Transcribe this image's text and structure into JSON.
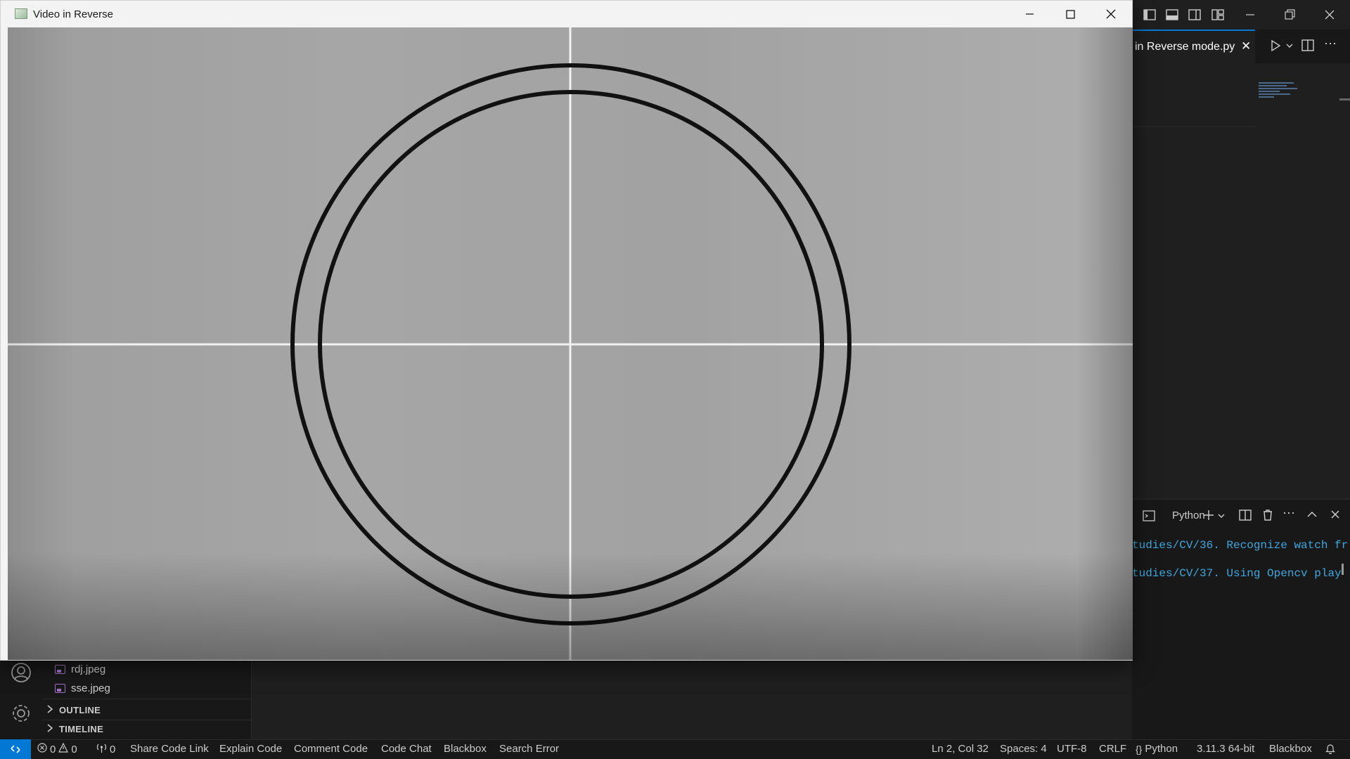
{
  "video_window": {
    "title": "Video in Reverse",
    "controls": [
      "minimize-icon",
      "maximize-icon",
      "close-icon"
    ],
    "frame": {
      "description_colors": {
        "background": "#a6a6a6",
        "rings": "#111111",
        "crosshair": "#ffffff"
      }
    }
  },
  "vscode": {
    "editor_tab": {
      "label": "in Reverse mode.py",
      "close": "✕"
    },
    "explorer": {
      "files": [
        {
          "name": "rdj.jpeg"
        },
        {
          "name": "sse.jpeg"
        }
      ],
      "sections": [
        "OUTLINE",
        "TIMELINE"
      ]
    },
    "terminal": {
      "name": "Python",
      "lines": [
        "tudies/CV/36. Recognize watch fr",
        "tudies/CV/37. Using Opencv play"
      ]
    },
    "status_bar": {
      "errors": "0",
      "warnings": "0",
      "ports": "0",
      "left_items": [
        "Share Code Link",
        "Explain Code",
        "Comment Code",
        "Code Chat",
        "Blackbox",
        "Search Error"
      ],
      "cursor": "Ln 2, Col 32",
      "spaces": "Spaces: 4",
      "encoding": "UTF-8",
      "eol": "CRLF",
      "language": "Python",
      "interpreter": "3.11.3 64-bit",
      "blackbox": "Blackbox"
    },
    "accent_color": "#0078d4"
  }
}
